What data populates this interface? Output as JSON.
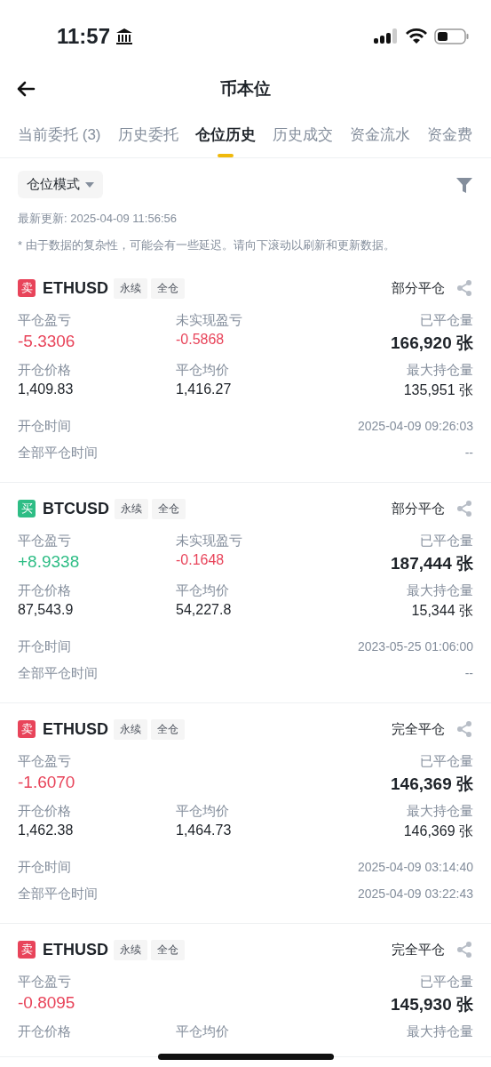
{
  "status_bar": {
    "time": "11:57"
  },
  "header": {
    "title": "币本位"
  },
  "tabs": [
    {
      "label": "当前委托 (3)",
      "selected": false
    },
    {
      "label": "历史委托",
      "selected": false
    },
    {
      "label": "仓位历史",
      "selected": true
    },
    {
      "label": "历史成交",
      "selected": false
    },
    {
      "label": "资金流水",
      "selected": false
    },
    {
      "label": "资金费",
      "selected": false
    }
  ],
  "mode_dropdown": {
    "label": "仓位模式"
  },
  "last_update": "最新更新: 2025-04-09 11:56:56",
  "notice": "* 由于数据的复杂性，可能会有一些延迟。请向下滚动以刷新和更新数据。",
  "positions": [
    {
      "color": "#e8445a",
      "side_label": "卖",
      "symbol": "ETHUSD",
      "tags": [
        "永续",
        "全仓"
      ],
      "status": "部分平仓",
      "pnl": {
        "label": "平仓盈亏",
        "value": "-5.3306",
        "color": "#e8445a"
      },
      "unrealized": {
        "label": "未实现盈亏",
        "value": "-0.5868",
        "color": "#e8445a"
      },
      "closed_qty": {
        "label": "已平仓量",
        "value": "166,920 张"
      },
      "open_price": {
        "label": "开仓价格",
        "value": "1,409.83"
      },
      "avg_close": {
        "label": "平仓均价",
        "value": "1,416.27"
      },
      "max_qty": {
        "label": "最大持仓量",
        "value": "135,951 张"
      },
      "times": [
        {
          "label": "开仓时间",
          "value": "2025-04-09 09:26:03"
        },
        {
          "label": "全部平仓时间",
          "value": "--"
        }
      ]
    },
    {
      "color": "#2ebd85",
      "side_label": "买",
      "symbol": "BTCUSD",
      "tags": [
        "永续",
        "全仓"
      ],
      "status": "部分平仓",
      "pnl": {
        "label": "平仓盈亏",
        "value": "+8.9338",
        "color": "#2ebd85"
      },
      "unrealized": {
        "label": "未实现盈亏",
        "value": "-0.1648",
        "color": "#e8445a"
      },
      "closed_qty": {
        "label": "已平仓量",
        "value": "187,444 张"
      },
      "open_price": {
        "label": "开仓价格",
        "value": "87,543.9"
      },
      "avg_close": {
        "label": "平仓均价",
        "value": "54,227.8"
      },
      "max_qty": {
        "label": "最大持仓量",
        "value": "15,344 张"
      },
      "times": [
        {
          "label": "开仓时间",
          "value": "2023-05-25 01:06:00"
        },
        {
          "label": "全部平仓时间",
          "value": "--"
        }
      ]
    },
    {
      "color": "#e8445a",
      "side_label": "卖",
      "symbol": "ETHUSD",
      "tags": [
        "永续",
        "全仓"
      ],
      "status": "完全平仓",
      "pnl": {
        "label": "平仓盈亏",
        "value": "-1.6070",
        "color": "#e8445a"
      },
      "closed_qty": {
        "label": "已平仓量",
        "value": "146,369 张"
      },
      "open_price": {
        "label": "开仓价格",
        "value": "1,462.38"
      },
      "avg_close": {
        "label": "平仓均价",
        "value": "1,464.73"
      },
      "max_qty": {
        "label": "最大持仓量",
        "value": "146,369 张"
      },
      "times": [
        {
          "label": "开仓时间",
          "value": "2025-04-09 03:14:40"
        },
        {
          "label": "全部平仓时间",
          "value": "2025-04-09 03:22:43"
        }
      ]
    },
    {
      "color": "#e8445a",
      "side_label": "卖",
      "symbol": "ETHUSD",
      "tags": [
        "永续",
        "全仓"
      ],
      "status": "完全平仓",
      "pnl": {
        "label": "平仓盈亏",
        "value": "-0.8095",
        "color": "#e8445a"
      },
      "closed_qty": {
        "label": "已平仓量",
        "value": "145,930 张"
      },
      "open_price": {
        "label": "开仓价格"
      },
      "avg_close": {
        "label": "平仓均价"
      },
      "max_qty": {
        "label": "最大持仓量"
      }
    }
  ]
}
